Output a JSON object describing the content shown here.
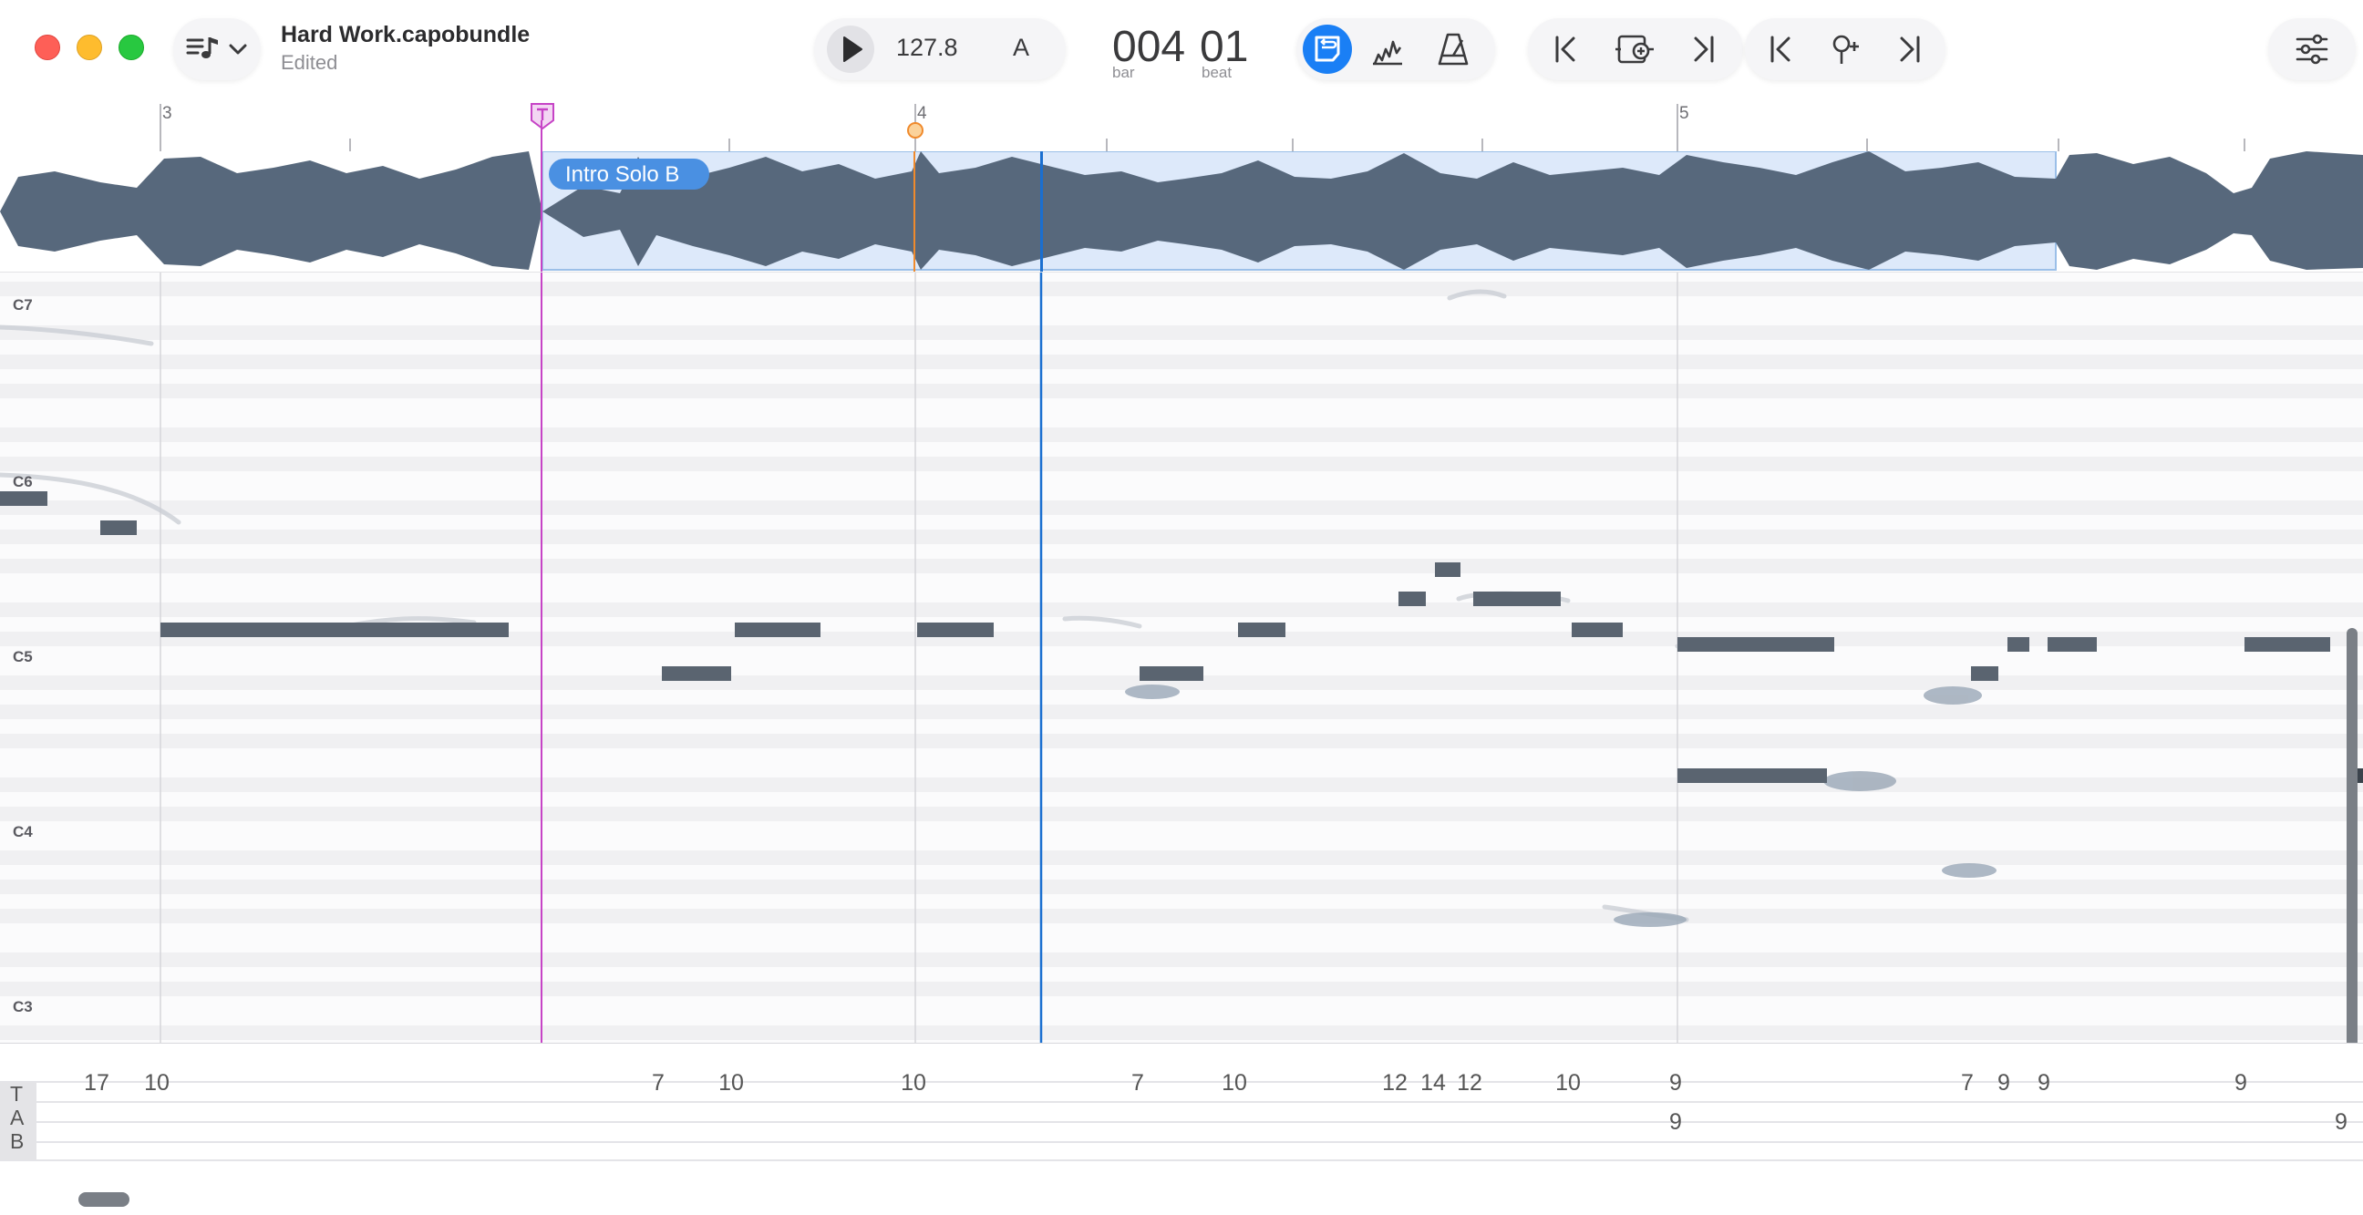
{
  "window": {
    "title": "Hard Work.capobundle",
    "subtitle": "Edited"
  },
  "transport": {
    "tempo": "127.8",
    "key": "A"
  },
  "position": {
    "bar": "004",
    "beat": "01",
    "bar_label": "bar",
    "beat_label": "beat"
  },
  "ruler": {
    "bars": [
      "3",
      "4",
      "5"
    ]
  },
  "region": {
    "label": "Intro Solo B"
  },
  "pitch_labels": [
    "C7",
    "C6",
    "C5",
    "C4",
    "C3"
  ],
  "tab": {
    "letters": [
      "T",
      "A",
      "B"
    ],
    "frets": [
      {
        "text": "17",
        "string": 1
      },
      {
        "text": "10",
        "string": 1
      },
      {
        "text": "7",
        "string": 1
      },
      {
        "text": "10",
        "string": 1
      },
      {
        "text": "10",
        "string": 1
      },
      {
        "text": "7",
        "string": 1
      },
      {
        "text": "10",
        "string": 1
      },
      {
        "text": "12",
        "string": 1
      },
      {
        "text": "14",
        "string": 1
      },
      {
        "text": "12",
        "string": 1
      },
      {
        "text": "10",
        "string": 1
      },
      {
        "text": "9",
        "string": 1
      },
      {
        "text": "9",
        "string": 2
      },
      {
        "text": "7",
        "string": 1
      },
      {
        "text": "9",
        "string": 1
      },
      {
        "text": "9",
        "string": 1
      },
      {
        "text": "9",
        "string": 1
      },
      {
        "text": "9",
        "string": 2
      }
    ]
  },
  "colors": {
    "accent": "#1a7ff5",
    "playhead": "#1a6fd0",
    "loop_marker": "#c643c6",
    "cursor_marker": "#f08a2c",
    "note": "#5a6470",
    "waveform": "#57687c"
  },
  "icons": [
    "song-menu-icon",
    "chevron-down-icon",
    "play-icon",
    "loop-icon",
    "beat-detect-icon",
    "metronome-icon",
    "skip-back-icon",
    "add-marker-icon",
    "skip-forward-icon",
    "prev-marker-icon",
    "pin-add-icon",
    "next-marker-icon",
    "settings-sliders-icon"
  ]
}
